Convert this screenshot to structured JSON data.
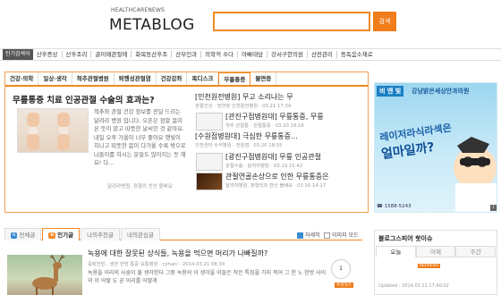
{
  "header": {
    "logo_small": "HEALTHCARENEWS",
    "logo_big": "METABLOG",
    "search_button": "검색"
  },
  "topnav": {
    "hot_label": "인기검색어",
    "items": [
      "산후증상",
      "산후조리",
      "골이매관절에",
      "화목동산후조",
      "산부인과",
      "의학적 수다",
      "아빠태담",
      "강서구한의원",
      "산전관리",
      "등독음소재로"
    ]
  },
  "tabs": [
    "건강·의학",
    "일상·생각",
    "척추관절병원",
    "퇴행성관절염",
    "건강강좌",
    "목디스크",
    "무릎통증",
    "불면증"
  ],
  "feature": {
    "title": "무릎통증 치료 인공관절 수술의 효과는?",
    "body1": "척추와 관절 건강 정보를 전달 드리는 달려라 병원 입니다. 오픈은 정말 봄이 온 듯이 맑고 따뜻한 날씨인 것 같아요. 내일 오후 가을이 너무 좋아요 햇빛이 지나고 따뜻한 봄이 다가올 수록 밖으로 나들이를 하시는 분들도 많아지는 듯 해요! 다...",
    "body2": "",
    "meta": "달려라병원, 정형외 찬산 볼배요"
  },
  "news": [
    {
      "title": "[인천원전병원] 무고 소리나는 무",
      "meta": "관절건강 · 정연정 인천원전병원 · 03.21 17:34"
    },
    {
      "title": "[관진구점병원대] 무릎통증, 무릎",
      "meta": "척추 관절통 · 관절통증 · 03.20 18:16"
    },
    {
      "title": "[수원점병원대] 극심한 무릎통증...",
      "meta": "인천센터 수석병원 · 전원점 · 03.20 18:55"
    },
    {
      "title": "[광진구점병원대] 무릎 인공관절",
      "meta": "관절수술 · 달려라병원 · 03.19 15:42"
    },
    {
      "title": "관절연골손상으로 인한 무릎통증은",
      "meta": "달려라병원, 정형외과 찬산 볼배요 · 03.16 14:17"
    }
  ],
  "ad": {
    "badge": "비 엔 빛",
    "sub": "강남밝은세상안과의원",
    "headline": "레이저라식라섹은",
    "headline2": "얼마일까?",
    "phone": "☎ 1588-5243"
  },
  "bottom": {
    "tabs": [
      "전체글",
      "인기글",
      "나의추천글",
      "내의관심글"
    ],
    "option_auto": "자세히",
    "option_image": "이미지 모드",
    "post_title": "녹용에 대한 잘못된 상식들, 녹용을 먹으면 머리가 나빠질까?",
    "post_meta": "중랑한방 · 생면 한방 통증 요통병원 · cyhani · 2014.03.21 08:34",
    "post_body": "녹용을 어리의 사숨이 불 생각한다 그중 녹용의 이 생각을 이들은 작은 특징을 가지 적어 그 한 노 한방 사이의 이 어떻 도 곧 이리를 어떻게",
    "reco_count": "1",
    "reco_label": "추천하기"
  },
  "side_box": {
    "title": "블로그스피어 핫이슈",
    "tabs": [
      "오늘",
      "어제",
      "주간"
    ],
    "badge": "REFRESH",
    "updated": "Updated : 2014.03.21 17:40:02"
  },
  "colors": {
    "accent": "#f08a24",
    "blue": "#1a7fc4"
  }
}
